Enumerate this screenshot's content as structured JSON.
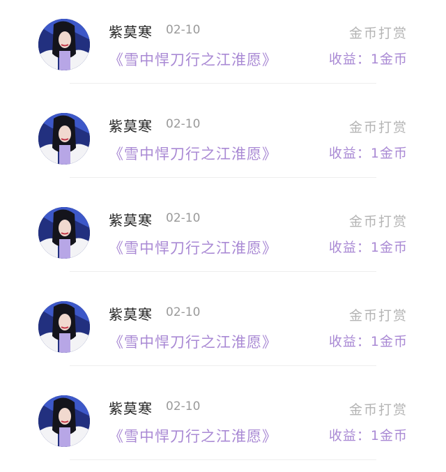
{
  "records": [
    {
      "user": "紫莫寒",
      "date": "02-10",
      "book": "《雪中悍刀行之江淮愿》",
      "tip_label": "金币打赏",
      "earnings": "收益：1金币"
    },
    {
      "user": "紫莫寒",
      "date": "02-10",
      "book": "《雪中悍刀行之江淮愿》",
      "tip_label": "金币打赏",
      "earnings": "收益：1金币"
    },
    {
      "user": "紫莫寒",
      "date": "02-10",
      "book": "《雪中悍刀行之江淮愿》",
      "tip_label": "金币打赏",
      "earnings": "收益：1金币"
    },
    {
      "user": "紫莫寒",
      "date": "02-10",
      "book": "《雪中悍刀行之江淮愿》",
      "tip_label": "金币打赏",
      "earnings": "收益：1金币"
    },
    {
      "user": "紫莫寒",
      "date": "02-10",
      "book": "《雪中悍刀行之江淮愿》",
      "tip_label": "金币打赏",
      "earnings": "收益：1金币"
    }
  ],
  "colors": {
    "accent": "#a989d4",
    "name": "#222222",
    "muted": "#9a9a9a",
    "tip": "#b4b4b4"
  },
  "avatar_icon": "user-photo-avatar"
}
